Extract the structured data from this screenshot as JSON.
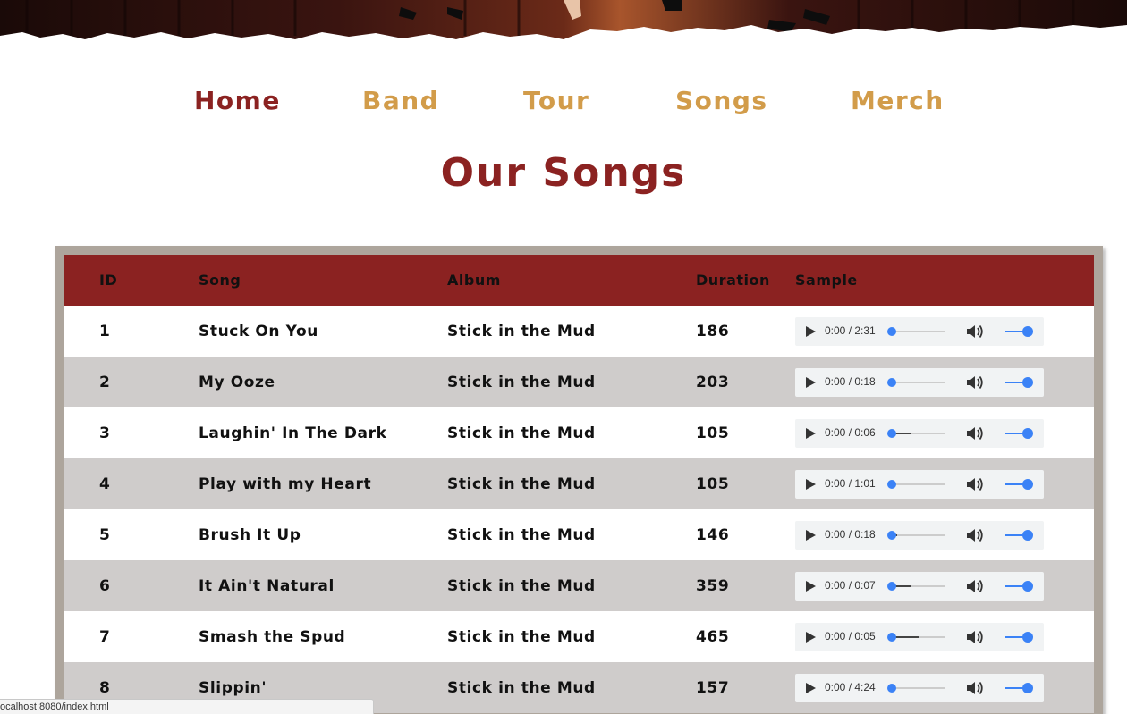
{
  "nav": {
    "items": [
      {
        "label": "Home",
        "active": true
      },
      {
        "label": "Band",
        "active": false
      },
      {
        "label": "Tour",
        "active": false
      },
      {
        "label": "Songs",
        "active": false
      },
      {
        "label": "Merch",
        "active": false
      }
    ]
  },
  "page": {
    "title": "Our Songs"
  },
  "table": {
    "headers": [
      "ID",
      "Song",
      "Album",
      "Duration",
      "Sample"
    ],
    "rows": [
      {
        "id": "1",
        "song": "Stuck On You",
        "album": "Stick in the Mud",
        "duration": "186",
        "sample_time": "0:00 / 2:31",
        "buffered": 0.0
      },
      {
        "id": "2",
        "song": "My Ooze",
        "album": "Stick in the Mud",
        "duration": "203",
        "sample_time": "0:00 / 0:18",
        "buffered": 0.0
      },
      {
        "id": "3",
        "song": "Laughin' In The Dark",
        "album": "Stick in the Mud",
        "duration": "105",
        "sample_time": "0:00 / 0:06",
        "buffered": 0.35
      },
      {
        "id": "4",
        "song": "Play with my Heart",
        "album": "Stick in the Mud",
        "duration": "105",
        "sample_time": "0:00 / 1:01",
        "buffered": 0.0
      },
      {
        "id": "5",
        "song": "Brush It Up",
        "album": "Stick in the Mud",
        "duration": "146",
        "sample_time": "0:00 / 0:18",
        "buffered": 0.1
      },
      {
        "id": "6",
        "song": "It Ain't Natural",
        "album": "Stick in the Mud",
        "duration": "359",
        "sample_time": "0:00 / 0:07",
        "buffered": 0.38
      },
      {
        "id": "7",
        "song": "Smash the Spud",
        "album": "Stick in the Mud",
        "duration": "465",
        "sample_time": "0:00 / 0:05",
        "buffered": 0.5
      },
      {
        "id": "8",
        "song": "Slippin'",
        "album": "Stick in the Mud",
        "duration": "157",
        "sample_time": "0:00 / 4:24",
        "buffered": 0.0
      }
    ]
  },
  "status_bar": {
    "url": "ocalhost:8080/index.html"
  },
  "colors": {
    "accent": "#8b2221",
    "nav_link": "#d29c4a",
    "row_alt": "#cfcccb",
    "frame": "#ada59c",
    "player_blue": "#3b82f6"
  }
}
